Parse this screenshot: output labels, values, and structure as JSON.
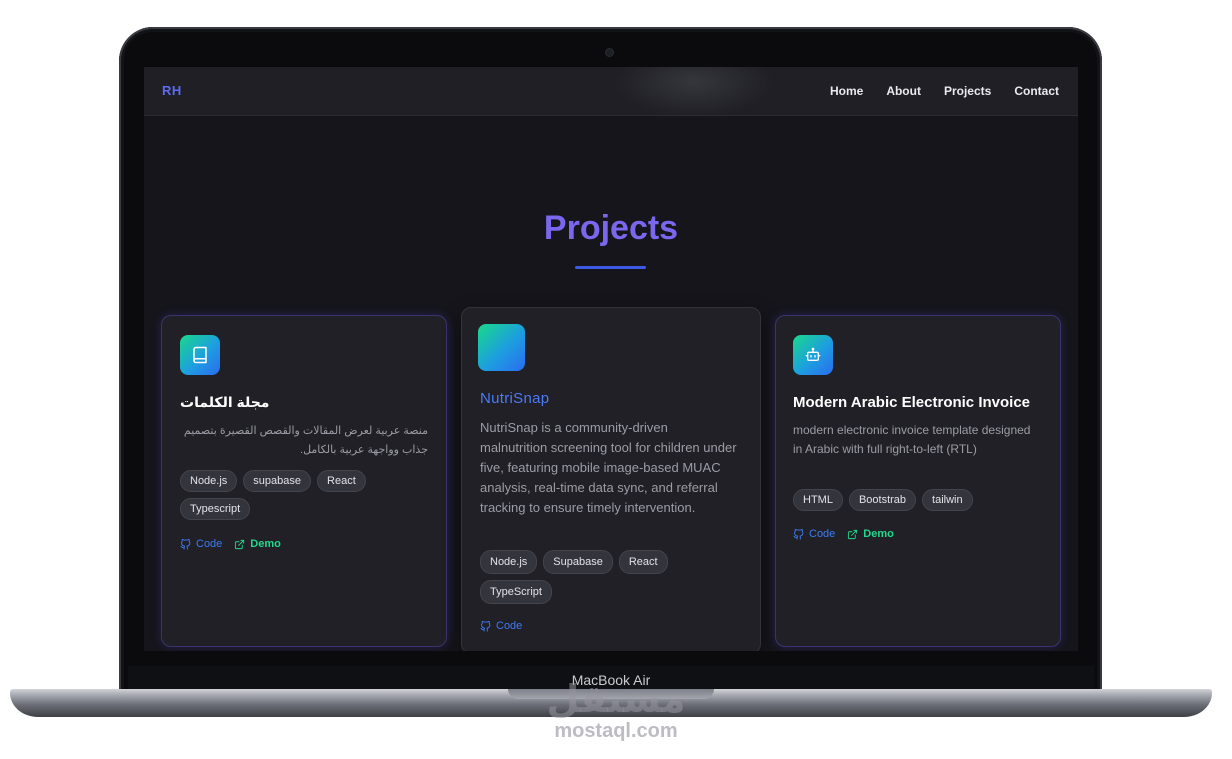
{
  "device": {
    "label": "MacBook Air",
    "watermark_arabic": "مستقل",
    "watermark_domain": "mostaql.com"
  },
  "navbar": {
    "logo": "RH",
    "links": [
      "Home",
      "About",
      "Projects",
      "Contact"
    ]
  },
  "section": {
    "title": "Projects"
  },
  "projects": [
    {
      "title": "مجلة الكلمات",
      "description": "منصة عربية لعرض المقالات والقصص القصيرة بتصميم جذاب وواجهة عربية بالكامل.",
      "tags": [
        "Node.js",
        "supabase",
        "React",
        "Typescript"
      ],
      "icon": "book-icon",
      "code_label": "Code",
      "demo_label": "Demo"
    },
    {
      "title": "NutriSnap",
      "description": "NutriSnap is a community-driven malnutrition screening tool for children under five, featuring mobile image-based MUAC analysis, real-time data sync, and referral tracking to ensure timely intervention.",
      "tags": [
        "Node.js",
        "Supabase",
        "React",
        "TypeScript"
      ],
      "icon": "gradient-icon",
      "code_label": "Code"
    },
    {
      "title": "Modern Arabic Electronic Invoice",
      "description": "modern electronic invoice template designed in Arabic with full right-to-left (RTL)",
      "tags": [
        "HTML",
        "Bootstrab",
        "tailwin"
      ],
      "icon": "robot-icon",
      "code_label": "Code",
      "demo_label": "Demo"
    }
  ],
  "colors": {
    "accent_title": "#7a67ee",
    "code_link": "#3d7bf3",
    "demo_link": "#22d68c",
    "screen_bg": "#15151b"
  }
}
